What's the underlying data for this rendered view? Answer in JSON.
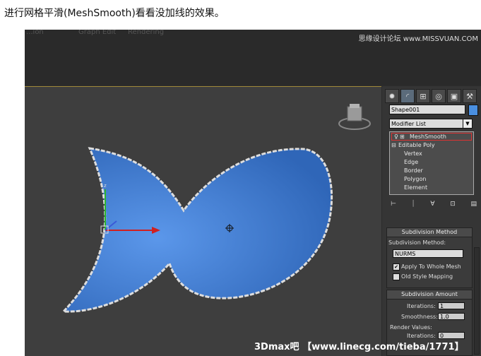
{
  "caption": "进行网格平滑(MeshSmooth)看看没加线的效果。",
  "header": {
    "menu_ghost_1": "...ion",
    "menu_ghost_2": "Graph Edit",
    "menu_ghost_3": "Rendering",
    "site_logo": "思缘设计论坛 www.MISSVUAN.COM"
  },
  "tabs": [
    "create-icon",
    "modify-icon",
    "hierarchy-icon",
    "motion-icon",
    "display-icon",
    "utilities-icon"
  ],
  "object_name": "Shape001",
  "object_color": "#4a8fe0",
  "modifier_list_label": "Modifier List",
  "stack": {
    "modifier": "MeshSmooth",
    "base": "Editable Poly",
    "sub": [
      "Vertex",
      "Edge",
      "Border",
      "Polygon",
      "Element"
    ]
  },
  "subdivision_method": {
    "title": "Subdivision Method",
    "label": "Subdivision Method:",
    "value": "NURMS",
    "apply_whole_mesh": "Apply To Whole Mesh",
    "old_style": "Old Style Mapping"
  },
  "subdivision_amount": {
    "title": "Subdivision Amount",
    "iterations_label": "Iterations:",
    "iterations_value": "1",
    "smoothness_label": "Smoothness:",
    "smoothness_value": "1.0",
    "render_values_label": "Render Values:",
    "render_iterations_label": "Iterations:",
    "render_iterations_value": "0"
  },
  "watermark": "3Dmax吧 【www.linecg.com/tieba/1771】"
}
